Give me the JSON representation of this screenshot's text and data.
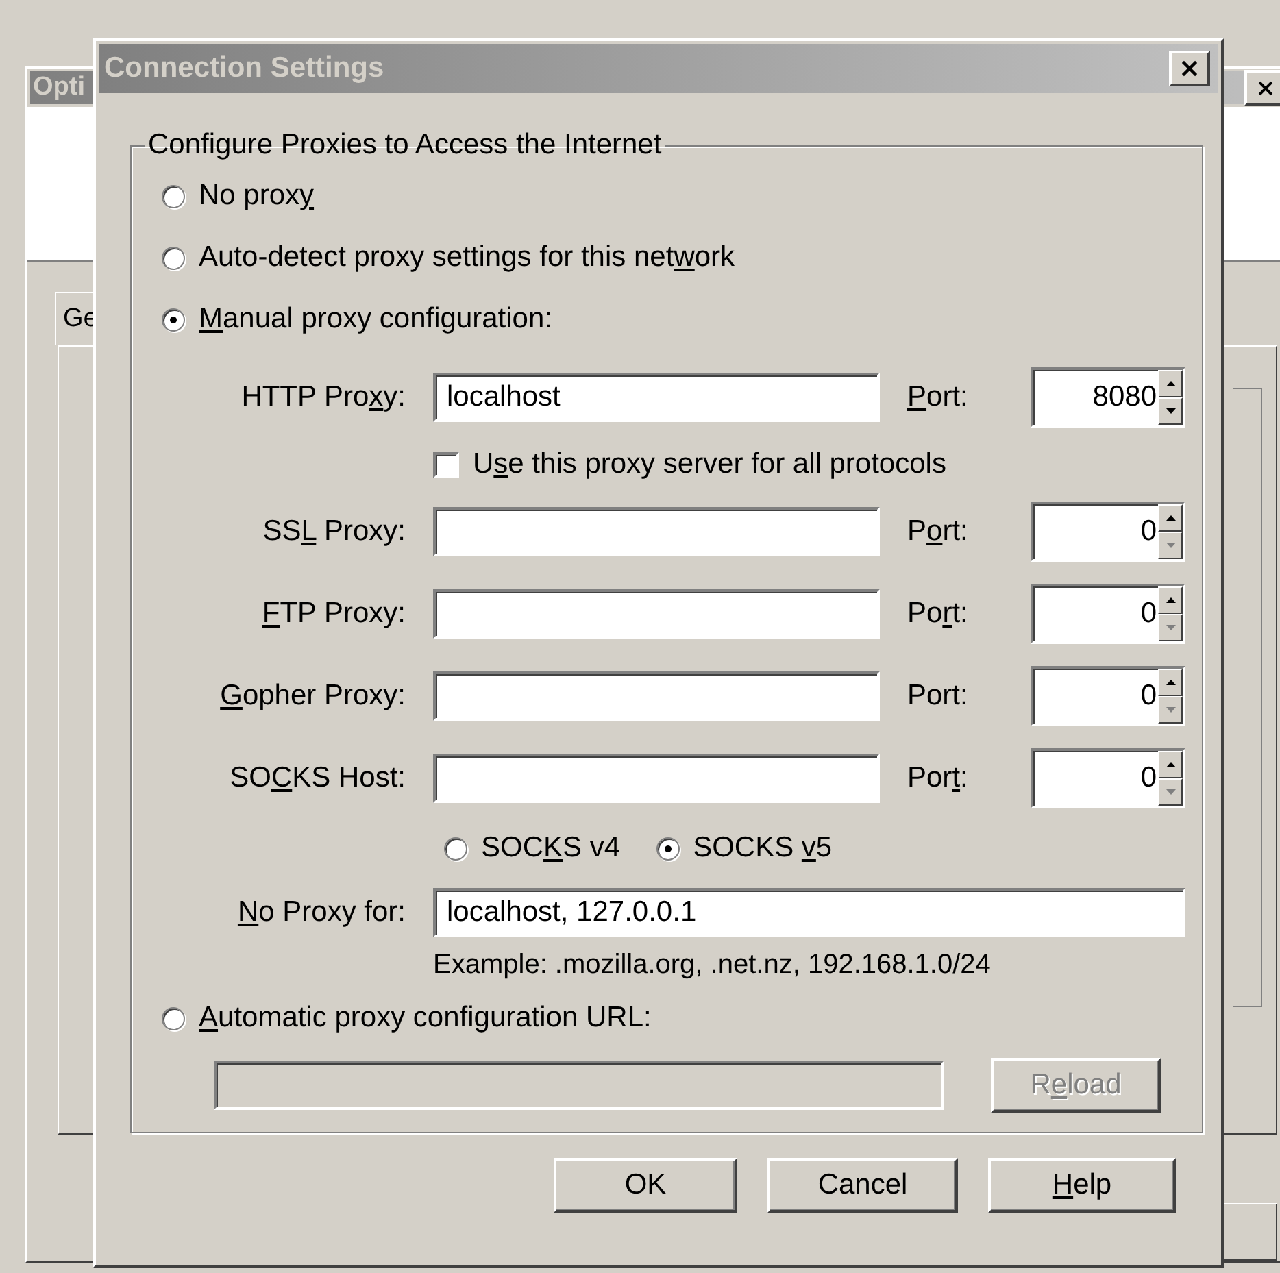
{
  "background_window": {
    "title": "Opti",
    "tab": "Ge"
  },
  "dialog": {
    "title": "Connection Settings",
    "group_title": "Configure Proxies to Access the Internet",
    "proxy_options": [
      {
        "label": {
          "pre": "No prox",
          "key": "y"
        },
        "selected": false
      },
      {
        "label": {
          "pre": "Auto-detect proxy settings for this net",
          "key": "w",
          "post": "ork"
        },
        "selected": false
      },
      {
        "label": {
          "key": "M",
          "post": "anual proxy configuration:"
        },
        "selected": true
      },
      {
        "label": {
          "key": "A",
          "post": "utomatic proxy configuration URL:"
        },
        "selected": false
      }
    ],
    "proxies": [
      {
        "label": {
          "pre": "HTTP Pro",
          "key": "x",
          "post": "y:"
        },
        "value": "localhost",
        "port_label": {
          "key": "P",
          "post": "ort:"
        },
        "port": "8080",
        "down_disabled": false
      },
      {
        "label": {
          "pre": "SS",
          "key": "L",
          "post": " Proxy:"
        },
        "port_label": {
          "pre": "P",
          "key": "o",
          "post": "rt:"
        },
        "port": "0",
        "down_disabled": true
      },
      {
        "label": {
          "key": "F",
          "post": "TP Proxy:"
        },
        "port_label": {
          "pre": "Po",
          "key": "r",
          "post": "t:"
        },
        "port": "0",
        "down_disabled": true
      },
      {
        "label": {
          "key": "G",
          "post": "opher Proxy:"
        },
        "port_label": "Port:",
        "port": "0",
        "down_disabled": true
      },
      {
        "label": {
          "pre": "SO",
          "key": "C",
          "post": "KS Host:"
        },
        "port_label": {
          "pre": "Por",
          "key": "t",
          "post": ":"
        },
        "port": "0",
        "down_disabled": true
      }
    ],
    "all_protocols": {
      "label": {
        "pre": "U",
        "key": "s",
        "post": "e this proxy server for all protocols"
      },
      "checked": false
    },
    "socks_versions": [
      {
        "label": {
          "pre": "SOC",
          "key": "K",
          "post": "S v4"
        },
        "selected": false
      },
      {
        "label": {
          "pre": "SOCKS ",
          "key": "v",
          "post": "5"
        },
        "selected": true
      }
    ],
    "no_proxy": {
      "label": {
        "key": "N",
        "post": "o Proxy for:"
      },
      "value": "localhost, 127.0.0.1"
    },
    "example": "Example: .mozilla.org, .net.nz, 192.168.1.0/24",
    "auto_url": {
      "disabled": true,
      "reload": {
        "label": {
          "pre": "R",
          "key": "e",
          "post": "load"
        },
        "disabled": true
      }
    },
    "buttons": [
      {
        "label": "OK"
      },
      {
        "label": "Cancel"
      },
      {
        "label": {
          "key": "H",
          "post": "elp"
        }
      }
    ]
  }
}
